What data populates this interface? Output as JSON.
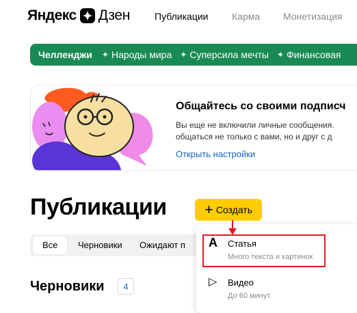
{
  "header": {
    "logo_part1": "Яндекс",
    "logo_part2": "Дзен",
    "nav": [
      "Публикации",
      "Карма",
      "Монетизация"
    ]
  },
  "challenges": {
    "title": "Челленджи",
    "items": [
      "Народы мира",
      "Суперсила мечты",
      "Финансовая"
    ]
  },
  "banner": {
    "title": "Общайтесь со своими подписч",
    "text_line1": "Вы еще не включили личные сообщения.",
    "text_line2": "общаться не только с вами, но и друг с д",
    "link": "Открыть настройки"
  },
  "page": {
    "title": "Публикации",
    "create_label": "Создать"
  },
  "tabs": [
    "Все",
    "Черновики",
    "Ожидают п"
  ],
  "drafts": {
    "title": "Черновики",
    "count": "4"
  },
  "create_menu": {
    "items": [
      {
        "icon": "A",
        "label": "Статья",
        "desc": "Много текста и картинок"
      },
      {
        "icon": "▷",
        "label": "Видео",
        "desc": "До 60 минут"
      }
    ]
  },
  "colors": {
    "strip": "#1a8a55",
    "create_button": "#ffcc00",
    "link": "#1466c4",
    "highlight": "#e01b1b"
  }
}
